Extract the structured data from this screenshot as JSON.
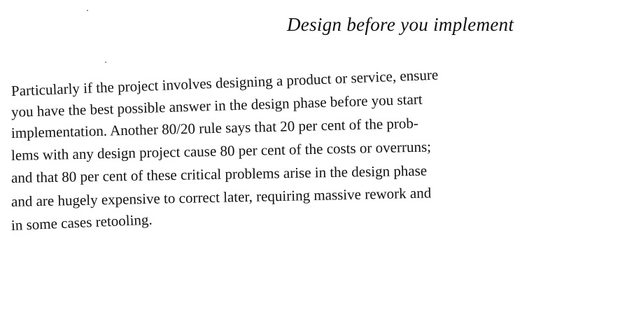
{
  "page": {
    "heading": "Design before you implement",
    "lines": [
      "Particularly if the project involves designing a product or service, ensure",
      "you have the best possible answer in the design phase before you start",
      "implementation. Another 80/20 rule says that 20 per cent of the prob-",
      "lems with any design project cause 80 per cent of the costs or overruns;",
      "and that 80 per cent of these critical problems arise in the design phase",
      "and are hugely expensive to correct later, requiring massive rework and",
      "in some cases retooling."
    ]
  }
}
